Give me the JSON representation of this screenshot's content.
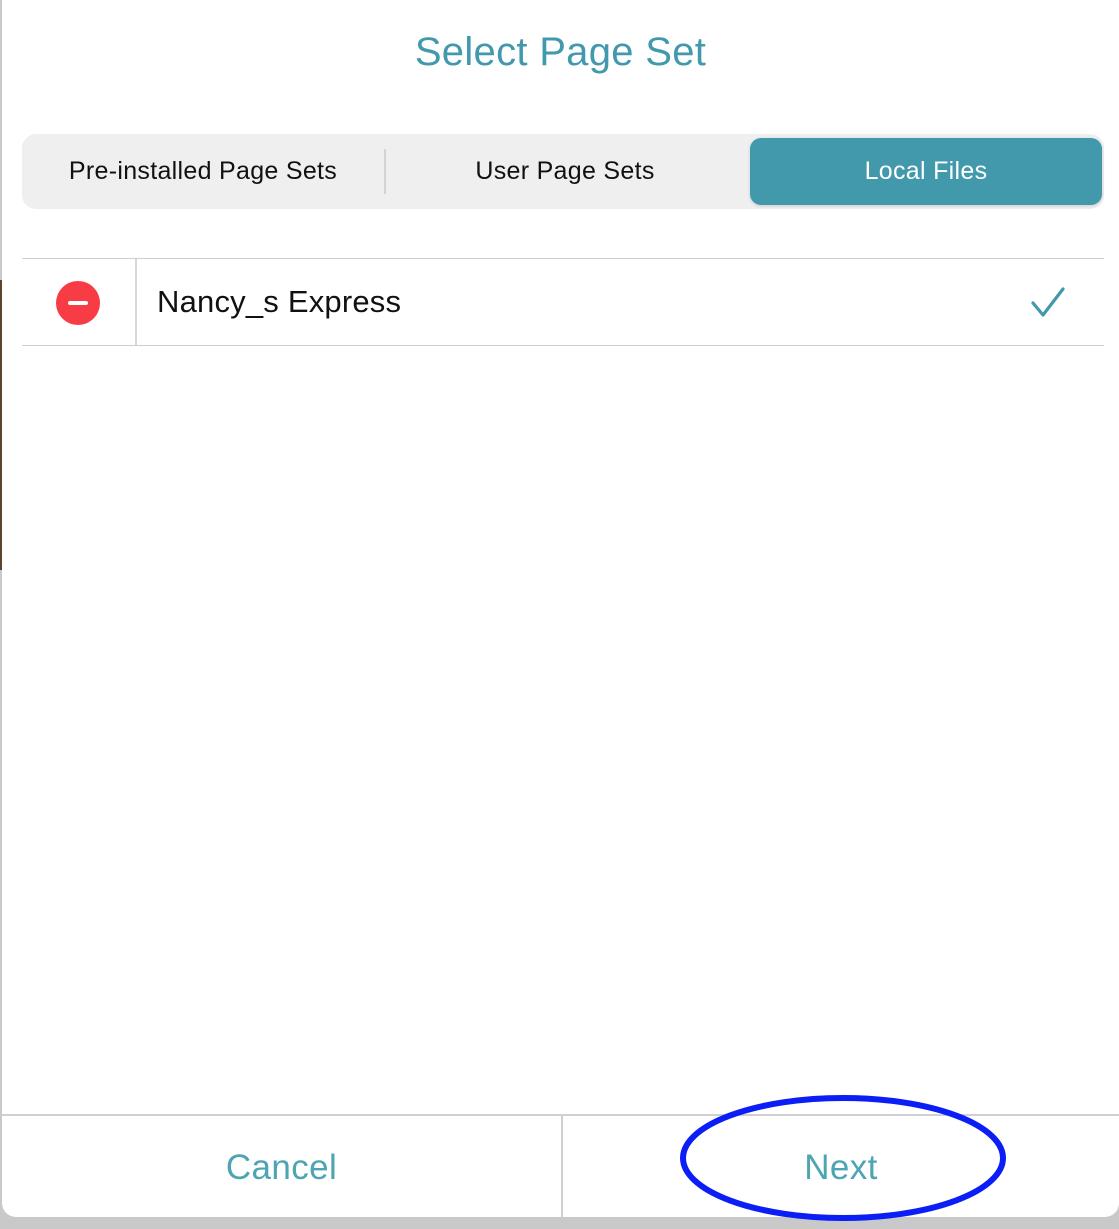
{
  "dialog": {
    "title": "Select Page Set"
  },
  "segmented_control": {
    "segments": [
      {
        "label": "Pre-installed Page Sets",
        "selected": false
      },
      {
        "label": "User Page Sets",
        "selected": false
      },
      {
        "label": "Local Files",
        "selected": true
      }
    ],
    "accent_color": "#4299ab"
  },
  "file_list": {
    "items": [
      {
        "label": "Nancy_s Express",
        "checked": true,
        "delete_icon": "minus-circle-icon",
        "check_icon": "checkmark-icon"
      }
    ]
  },
  "footer": {
    "cancel_label": "Cancel",
    "next_label": "Next"
  },
  "annotation": {
    "highlight": "Next",
    "highlight_color": "#0a1ef5"
  },
  "colors": {
    "delete_red": "#f73c45",
    "button_text": "#4da4b3"
  }
}
